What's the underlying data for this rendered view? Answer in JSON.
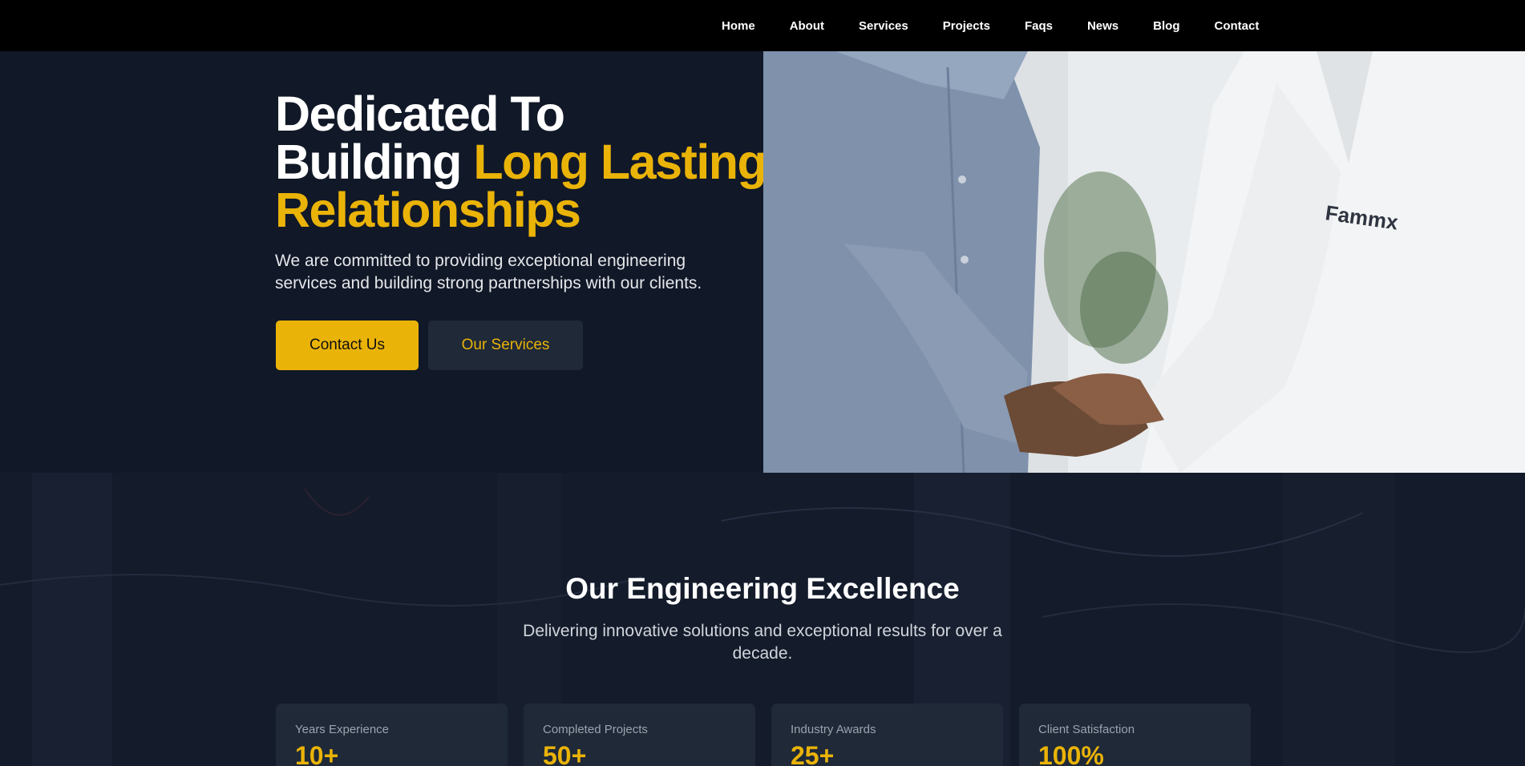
{
  "nav": {
    "items": [
      "Home",
      "About",
      "Services",
      "Projects",
      "Faqs",
      "News",
      "Blog",
      "Contact"
    ]
  },
  "hero": {
    "title_line1": "Dedicated To",
    "title_line2_plain": "Building",
    "title_line2_accent": "Long Lasting",
    "title_line3_accent": "Relationships",
    "description": "We are committed to providing exceptional engineering services and building strong partnerships with our clients.",
    "primary_button": "Contact Us",
    "secondary_button": "Our Services",
    "image_logo_text": "Fammx"
  },
  "excellence": {
    "title": "Our Engineering Excellence",
    "subtitle": "Delivering innovative solutions and exceptional results for over a decade.",
    "stats": [
      {
        "label": "Years Experience",
        "value": "10+"
      },
      {
        "label": "Completed Projects",
        "value": "50+"
      },
      {
        "label": "Industry Awards",
        "value": "25+"
      },
      {
        "label": "Client Satisfaction",
        "value": "100%"
      }
    ]
  },
  "colors": {
    "accent": "#eab308",
    "background": "#111827",
    "card": "#1f2937",
    "nav_bg": "#000000"
  }
}
